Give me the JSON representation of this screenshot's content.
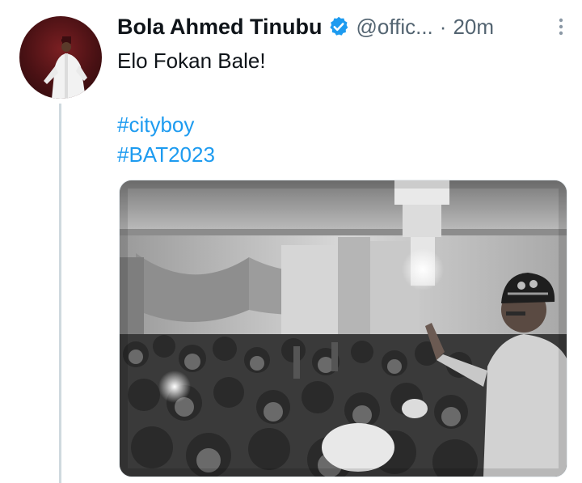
{
  "tweet": {
    "author_name": "Bola Ahmed Tinubu",
    "handle": "@offic...",
    "separator": "·",
    "time": "20m",
    "text": "Elo Fokan Bale!",
    "hashtags": [
      "#cityboy",
      "#BAT2023"
    ]
  },
  "icons": {
    "verified": "verified-badge-icon",
    "more": "more-vertical-icon"
  },
  "colors": {
    "link": "#1d9bf0",
    "verified": "#1d9bf0",
    "secondary_text": "#536471",
    "thread_line": "#cfd9de"
  }
}
